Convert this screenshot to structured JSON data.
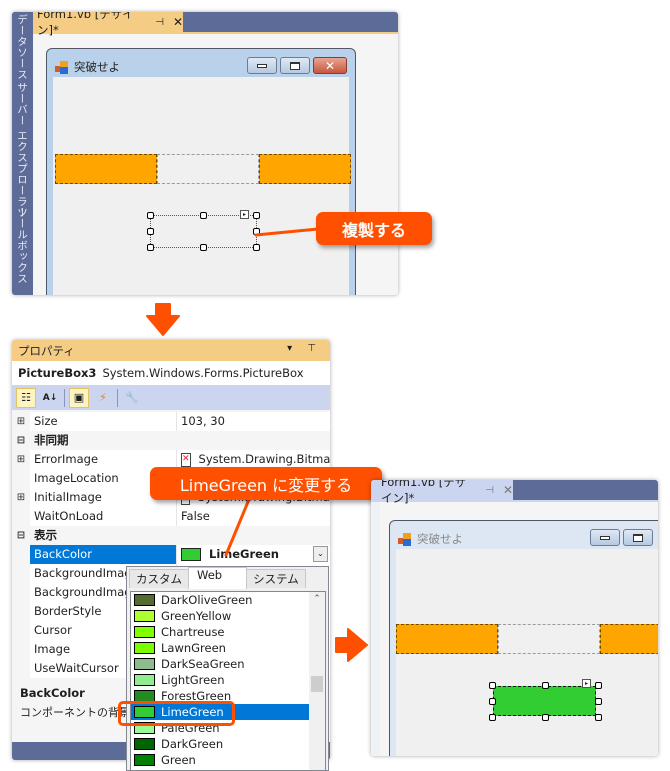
{
  "designer_top": {
    "tab_title": "Form1.vb [デザイン]*",
    "tab_pin": "⊣",
    "tab_close": "✕",
    "side_panels": [
      "データソース",
      "サーバー エクスプローラー",
      "ツールボックス"
    ],
    "form_title": "突破せよ",
    "window_buttons": {
      "minimize": "",
      "maximize": "",
      "close": "✕"
    },
    "callout": "複製する"
  },
  "properties": {
    "title": "プロパティ",
    "title_icons": "▾ ⊤",
    "object_name": "PictureBox3",
    "object_type": "System.Windows.Forms.PictureBox",
    "toolbar": {
      "categorized": "☷",
      "alphabetical": "A↓",
      "properties": "▣",
      "events": "⚡",
      "property_pages": "🔧"
    },
    "rows": [
      {
        "type": "prop",
        "expand": "⊞",
        "name": "Size",
        "value": "103, 30"
      },
      {
        "type": "cat",
        "expand": "⊟",
        "name": "非同期"
      },
      {
        "type": "prop",
        "expand": "⊞",
        "name": "ErrorImage",
        "value": "System.Drawing.Bitmap",
        "icon": "✕"
      },
      {
        "type": "prop",
        "expand": "",
        "name": "ImageLocation",
        "value": ""
      },
      {
        "type": "prop",
        "expand": "⊞",
        "name": "InitialImage",
        "value": "System.Drawing.Bitmap",
        "icon": "▲"
      },
      {
        "type": "prop",
        "expand": "",
        "name": "WaitOnLoad",
        "value": "False"
      },
      {
        "type": "cat",
        "expand": "⊟",
        "name": "表示"
      },
      {
        "type": "sel",
        "expand": "",
        "name": "BackColor",
        "value": "LimeGreen",
        "swatch": "#32cd32"
      },
      {
        "type": "prop",
        "expand": "",
        "name": "BackgroundImage",
        "value": ""
      },
      {
        "type": "prop",
        "expand": "",
        "name": "BackgroundImageLayout",
        "value": ""
      },
      {
        "type": "prop",
        "expand": "",
        "name": "BorderStyle",
        "value": ""
      },
      {
        "type": "prop",
        "expand": "",
        "name": "Cursor",
        "value": ""
      },
      {
        "type": "prop",
        "expand": "",
        "name": "Image",
        "value": ""
      },
      {
        "type": "prop",
        "expand": "",
        "name": "UseWaitCursor",
        "value": ""
      }
    ],
    "description_title": "BackColor",
    "description_text": "コンポーネントの背景色",
    "dropdown_arrow": "⌄",
    "callout": "LimeGreen に変更する"
  },
  "color_picker": {
    "tabs": [
      "カスタム",
      "Web",
      "システム"
    ],
    "active_tab": 1,
    "scroll_up": "⌃",
    "colors": [
      {
        "name": "DarkOliveGreen",
        "hex": "#556b2f"
      },
      {
        "name": "GreenYellow",
        "hex": "#adff2f"
      },
      {
        "name": "Chartreuse",
        "hex": "#7fff00"
      },
      {
        "name": "LawnGreen",
        "hex": "#7cfc00"
      },
      {
        "name": "DarkSeaGreen",
        "hex": "#8fbc8f"
      },
      {
        "name": "LightGreen",
        "hex": "#90ee90"
      },
      {
        "name": "ForestGreen",
        "hex": "#228b22"
      },
      {
        "name": "LimeGreen",
        "hex": "#32cd32",
        "selected": true
      },
      {
        "name": "PaleGreen",
        "hex": "#98fb98"
      },
      {
        "name": "DarkGreen",
        "hex": "#006400"
      },
      {
        "name": "Green",
        "hex": "#008000"
      }
    ]
  },
  "designer_result": {
    "tab_title": "Form1.vb [デザイン]*",
    "tab_pin": "⊣",
    "tab_close": "✕",
    "form_title": "突破せよ",
    "picturebox_color": "#32cd32"
  },
  "colors": {
    "accent_orange": "#fe5000",
    "bar_orange": "#ffa500",
    "vs_header": "#5d6b99",
    "vs_tab_active": "#f5cc84",
    "selection_blue": "#0078d7"
  }
}
